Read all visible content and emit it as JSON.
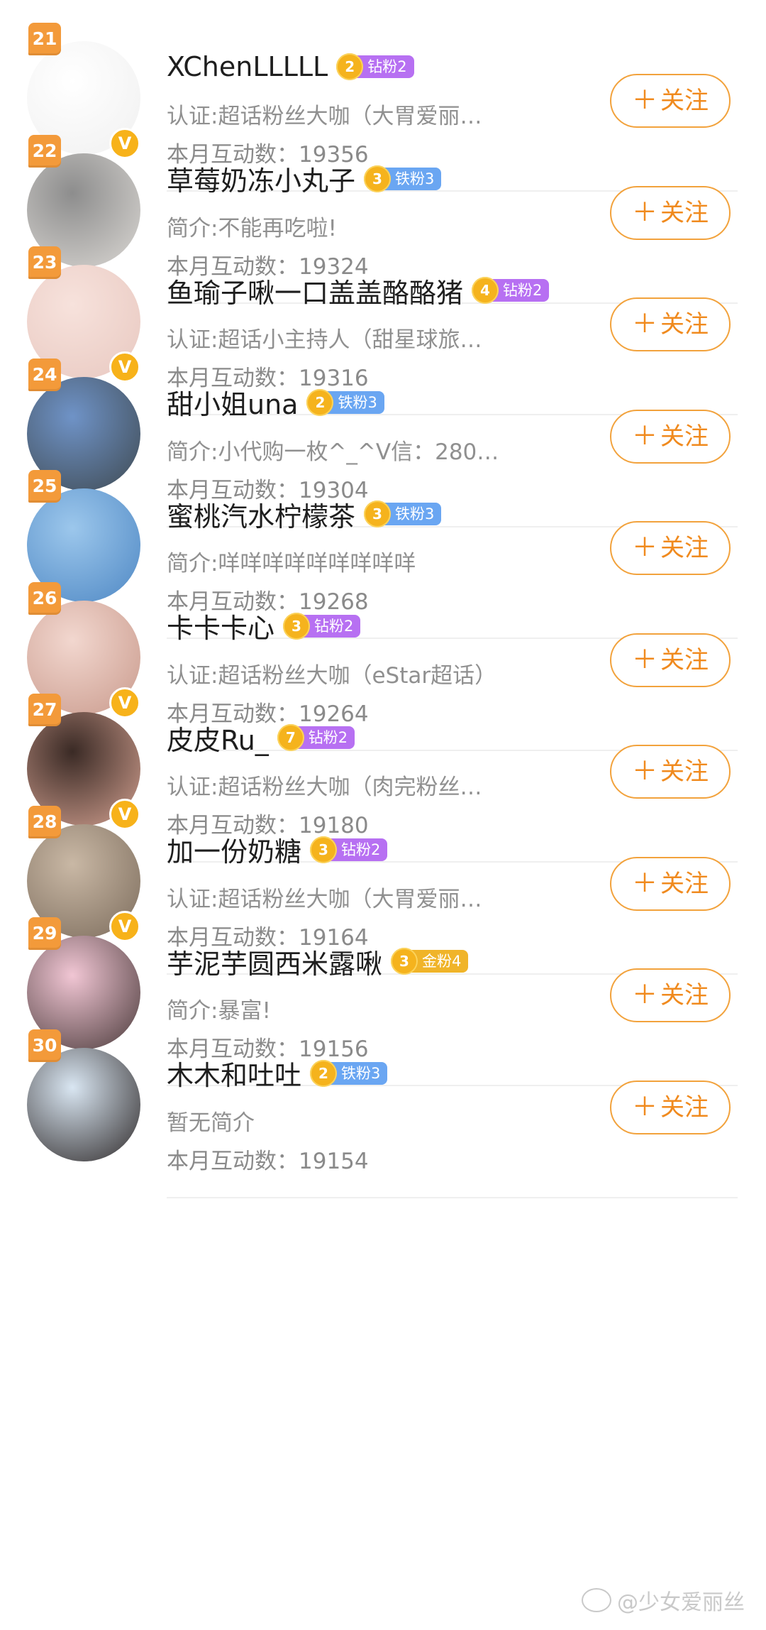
{
  "list": [
    {
      "rank": "21",
      "name": "XChenLLLLL",
      "fan_level": "2",
      "fan_label": "钻粉2",
      "fan_color": "#b770f2",
      "desc": "认证:超话粉丝大咖（大胃爱丽…",
      "stat": "本月互动数：19356",
      "verified": true,
      "follow_label": "关注",
      "avatar_colors": [
        "#ffffff",
        "#f0f0f0"
      ]
    },
    {
      "rank": "22",
      "name": "草莓奶冻小丸子",
      "fan_level": "3",
      "fan_label": "铁粉3",
      "fan_color": "#6aa6f2",
      "desc": "简介:不能再吃啦!",
      "stat": "本月互动数：19324",
      "verified": false,
      "follow_label": "关注",
      "avatar_colors": [
        "#8d8d8d",
        "#dad7d3"
      ]
    },
    {
      "rank": "23",
      "name": "鱼瑜子啾一口盖盖酪酪猪",
      "fan_level": "4",
      "fan_label": "钻粉2",
      "fan_color": "#b770f2",
      "desc": "认证:超话小主持人（甜星球旅…",
      "stat": "本月互动数：19316",
      "verified": true,
      "follow_label": "关注",
      "avatar_colors": [
        "#f7e2dc",
        "#e8c8c0"
      ]
    },
    {
      "rank": "24",
      "name": "甜小姐una",
      "fan_level": "2",
      "fan_label": "铁粉3",
      "fan_color": "#6aa6f2",
      "desc": "简介:小代购一枚^_^V信：280…",
      "stat": "本月互动数：19304",
      "verified": false,
      "follow_label": "关注",
      "avatar_colors": [
        "#6f93c7",
        "#3f4a52"
      ]
    },
    {
      "rank": "25",
      "name": "蜜桃汽水柠檬茶",
      "fan_level": "3",
      "fan_label": "铁粉3",
      "fan_color": "#6aa6f2",
      "desc": "简介:咩咩咩咩咩咩咩咩咩",
      "stat": "本月互动数：19268",
      "verified": false,
      "follow_label": "关注",
      "avatar_colors": [
        "#9cc7ec",
        "#4f88c4"
      ]
    },
    {
      "rank": "26",
      "name": "卡卡卡心",
      "fan_level": "3",
      "fan_label": "钻粉2",
      "fan_color": "#b770f2",
      "desc": "认证:超话粉丝大咖（eStar超话）",
      "stat": "本月互动数：19264",
      "verified": true,
      "follow_label": "关注",
      "avatar_colors": [
        "#f2d7cf",
        "#c99a8c"
      ]
    },
    {
      "rank": "27",
      "name": "皮皮Ru_",
      "fan_level": "7",
      "fan_label": "钻粉2",
      "fan_color": "#b770f2",
      "desc": "认证:超话粉丝大咖（肉完粉丝…",
      "stat": "本月互动数：19180",
      "verified": true,
      "follow_label": "关注",
      "avatar_colors": [
        "#3a2a25",
        "#d2a090"
      ]
    },
    {
      "rank": "28",
      "name": "加一份奶糖",
      "fan_level": "3",
      "fan_label": "钻粉2",
      "fan_color": "#b770f2",
      "desc": "认证:超话粉丝大咖（大胃爱丽…",
      "stat": "本月互动数：19164",
      "verified": true,
      "follow_label": "关注",
      "avatar_colors": [
        "#c9b8a5",
        "#7c6c5c"
      ]
    },
    {
      "rank": "29",
      "name": "芋泥芋圆西米露啾",
      "fan_level": "3",
      "fan_label": "金粉4",
      "fan_color": "#f0b429",
      "desc": "简介:暴富!",
      "stat": "本月互动数：19156",
      "verified": false,
      "follow_label": "关注",
      "avatar_colors": [
        "#f1c6d4",
        "#4a3a3a"
      ]
    },
    {
      "rank": "30",
      "name": "木木和吐吐",
      "fan_level": "2",
      "fan_label": "铁粉3",
      "fan_color": "#6aa6f2",
      "desc": "暂无简介",
      "stat": "本月互动数：19154",
      "verified": false,
      "follow_label": "关注",
      "avatar_colors": [
        "#d9e6f2",
        "#2f2a2a"
      ]
    }
  ],
  "plus_glyph": "＋",
  "verified_glyph": "V",
  "watermark": "@少女爱丽丝"
}
